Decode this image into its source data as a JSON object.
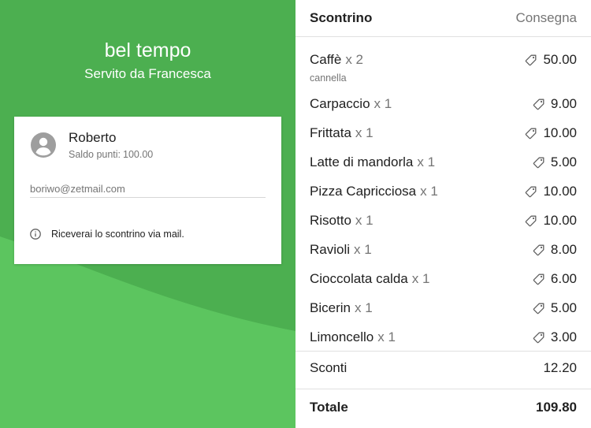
{
  "header": {
    "shop_name": "bel tempo",
    "served_by": "Servito da Francesca"
  },
  "customer": {
    "name": "Roberto",
    "points_label": "Saldo punti:",
    "points_value": "100.00",
    "email": "boriwo@zetmail.com",
    "info_text": "Riceverai lo scontrino via mail."
  },
  "tabs": {
    "receipt": "Scontrino",
    "delivery": "Consegna"
  },
  "items": [
    {
      "name": "Caffè",
      "qty": "x 2",
      "note": "cannella",
      "price": "50.00"
    },
    {
      "name": "Carpaccio",
      "qty": "x 1",
      "price": "9.00"
    },
    {
      "name": "Frittata",
      "qty": "x 1",
      "price": "10.00"
    },
    {
      "name": "Latte di mandorla",
      "qty": "x 1",
      "price": "5.00"
    },
    {
      "name": "Pizza Capricciosa",
      "qty": "x 1",
      "price": "10.00"
    },
    {
      "name": "Risotto",
      "qty": "x 1",
      "price": "10.00"
    },
    {
      "name": "Ravioli",
      "qty": "x 1",
      "price": "8.00"
    },
    {
      "name": "Cioccolata calda",
      "qty": "x 1",
      "price": "6.00"
    },
    {
      "name": "Bicerin",
      "qty": "x 1",
      "price": "5.00"
    },
    {
      "name": "Limoncello",
      "qty": "x 1",
      "price": "3.00"
    }
  ],
  "summary": {
    "discount_label": "Sconti",
    "discount_value": "12.20",
    "total_label": "Totale",
    "total_value": "109.80"
  },
  "icons": {
    "avatar": "account-circle-icon",
    "info": "info-outline-icon",
    "price": "tag-icon"
  },
  "colors": {
    "brand_green": "#4caf50",
    "wave_green": "#5cc55f"
  }
}
